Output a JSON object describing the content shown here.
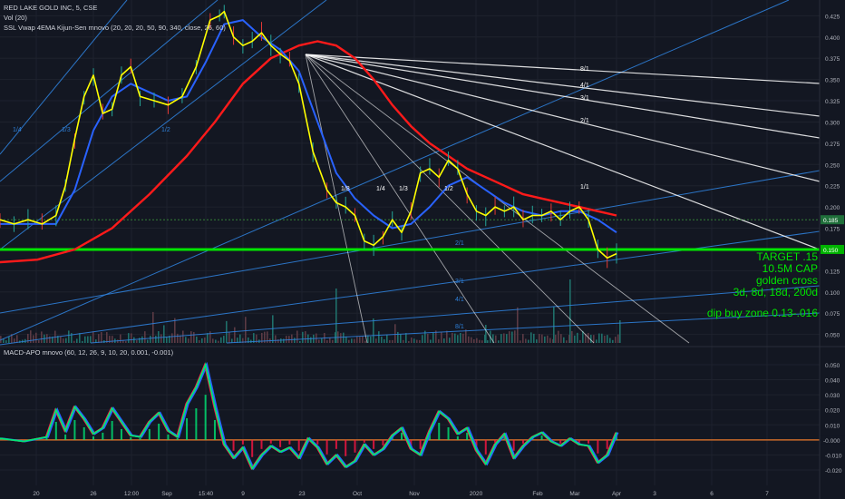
{
  "header": {
    "title": "RED LAKE GOLD INC, 5, CSE",
    "vol": "Vol (20)",
    "indicator": "SSL Vwap 4EMA Kijun-Sen mnovo (20, 20, 20, 50, 90, 340, close, 26, 60)",
    "macd": "MACD-APO mnovo (60, 12, 26, 9, 10, 20, 0.001, -0.001)"
  },
  "annotations": {
    "target": "TARGET .15",
    "cap": "10.5M CAP",
    "cross": "golden cross",
    "periods": "3d, 8d, 18d, 200d",
    "dip": "dip buy zone 0.13-.016"
  },
  "colors": {
    "background": "#131722",
    "price": "#ffff00",
    "ema_blue": "#2962ff",
    "ema_red": "#ff1a1a",
    "target_line": "#00e600",
    "fan": "#ffffff",
    "gann_blue": "#2e7fd8",
    "macd_green": "#00e676",
    "macd_red": "#ff1744",
    "macd_blue": "#2962ff"
  },
  "chart_data": {
    "type": "line",
    "x_ticks": [
      "20",
      "26",
      "12:00",
      "Sep",
      "15:40",
      "9",
      "23",
      "Oct",
      "Nov",
      "2020",
      "Feb",
      "Mar",
      "Apr",
      "3",
      "6",
      "7"
    ],
    "price_axis": {
      "ticks": [
        "0.425",
        "0.400",
        "0.375",
        "0.350",
        "0.325",
        "0.300",
        "0.275",
        "0.250",
        "0.225",
        "0.200",
        "0.175",
        "0.150",
        "0.125",
        "0.100",
        "0.075",
        "0.050"
      ],
      "range": [
        0.04,
        0.435
      ],
      "current_label": "0.185",
      "target_label": "0.150",
      "current_value": 0.185,
      "target_value": 0.15
    },
    "macd_axis": {
      "ticks": [
        "0.050",
        "0.040",
        "0.030",
        "0.020",
        "0.010",
        "0.000",
        "-0.010",
        "-0.020"
      ],
      "range": [
        -0.026,
        0.056
      ],
      "zero_label": "-0.000"
    },
    "fan_labels": [
      "8/1",
      "4/1",
      "3/1",
      "2/1",
      "1/1",
      "1/2",
      "1/3",
      "1/4",
      "1/8"
    ],
    "gann_labels": [
      "1/4",
      "1/3",
      "1/2",
      "2/1",
      "3/1",
      "4/1",
      "8/1"
    ],
    "x_domain": [
      0,
      132
    ],
    "series": [
      {
        "key": "price",
        "x": [
          0,
          3,
          6,
          9,
          12,
          14,
          16,
          18,
          20,
          22,
          24,
          26,
          28,
          30,
          33,
          36,
          39,
          42,
          45,
          47,
          48,
          50,
          52,
          54,
          56,
          58,
          60,
          62,
          64,
          67,
          70,
          72,
          74,
          76,
          78,
          80,
          82,
          84,
          86,
          88,
          90,
          92,
          94,
          96,
          98,
          100,
          102,
          104,
          106,
          108,
          110,
          112,
          114,
          116,
          118,
          120,
          122,
          124,
          126,
          128,
          130,
          132
        ],
        "values": [
          0.185,
          0.18,
          0.185,
          0.18,
          0.19,
          0.225,
          0.28,
          0.33,
          0.355,
          0.31,
          0.315,
          0.355,
          0.365,
          0.33,
          0.325,
          0.32,
          0.33,
          0.365,
          0.42,
          0.425,
          0.43,
          0.4,
          0.39,
          0.395,
          0.405,
          0.39,
          0.38,
          0.372,
          0.345,
          0.265,
          0.22,
          0.205,
          0.2,
          0.19,
          0.16,
          0.155,
          0.165,
          0.185,
          0.17,
          0.195,
          0.24,
          0.245,
          0.235,
          0.255,
          0.245,
          0.215,
          0.195,
          0.19,
          0.2,
          0.195,
          0.2,
          0.185,
          0.19,
          0.19,
          0.195,
          0.185,
          0.195,
          0.2,
          0.185,
          0.15,
          0.14,
          0.145
        ]
      },
      {
        "key": "ema_blue",
        "x": [
          0,
          6,
          12,
          16,
          20,
          24,
          28,
          32,
          36,
          40,
          44,
          48,
          52,
          56,
          60,
          64,
          68,
          72,
          76,
          80,
          84,
          88,
          92,
          96,
          100,
          104,
          108,
          112,
          116,
          120,
          124,
          128,
          132
        ],
        "values": [
          0.18,
          0.18,
          0.18,
          0.22,
          0.29,
          0.33,
          0.345,
          0.335,
          0.325,
          0.33,
          0.37,
          0.415,
          0.42,
          0.4,
          0.385,
          0.36,
          0.3,
          0.24,
          0.21,
          0.19,
          0.175,
          0.18,
          0.2,
          0.225,
          0.235,
          0.22,
          0.205,
          0.195,
          0.19,
          0.195,
          0.195,
          0.185,
          0.17
        ]
      },
      {
        "key": "ema_red",
        "x": [
          0,
          8,
          16,
          24,
          32,
          40,
          46,
          52,
          58,
          64,
          68,
          72,
          76,
          80,
          84,
          88,
          92,
          96,
          100,
          104,
          108,
          112,
          116,
          120,
          124,
          128,
          132
        ],
        "values": [
          0.135,
          0.138,
          0.15,
          0.175,
          0.215,
          0.26,
          0.3,
          0.345,
          0.375,
          0.39,
          0.395,
          0.39,
          0.375,
          0.35,
          0.32,
          0.295,
          0.275,
          0.26,
          0.245,
          0.235,
          0.225,
          0.215,
          0.21,
          0.205,
          0.2,
          0.195,
          0.19
        ]
      },
      {
        "key": "macd_main",
        "x": [
          0,
          5,
          10,
          12,
          14,
          16,
          18,
          20,
          22,
          24,
          26,
          28,
          30,
          32,
          34,
          36,
          38,
          40,
          42,
          44,
          46,
          48,
          50,
          52,
          54,
          56,
          58,
          60,
          62,
          64,
          66,
          68,
          70,
          72,
          74,
          76,
          78,
          80,
          82,
          84,
          86,
          88,
          90,
          92,
          94,
          96,
          98,
          100,
          102,
          104,
          106,
          108,
          110,
          112,
          114,
          116,
          118,
          120,
          122,
          124,
          126,
          128,
          130,
          132
        ],
        "values": [
          0.001,
          -0.001,
          0.002,
          0.02,
          0.006,
          0.022,
          0.014,
          0.004,
          0.008,
          0.021,
          0.012,
          0.003,
          0.002,
          0.012,
          0.018,
          0.006,
          0.002,
          0.024,
          0.035,
          0.05,
          0.022,
          -0.003,
          -0.012,
          -0.005,
          -0.019,
          -0.01,
          -0.004,
          -0.008,
          -0.005,
          -0.012,
          0.001,
          -0.005,
          -0.016,
          -0.01,
          -0.018,
          -0.014,
          -0.003,
          -0.01,
          -0.006,
          0.003,
          0.008,
          -0.006,
          -0.01,
          0.006,
          0.019,
          0.014,
          0.004,
          0.008,
          -0.007,
          -0.016,
          -0.003,
          0.004,
          -0.012,
          -0.004,
          0.002,
          0.005,
          -0.001,
          -0.004,
          0.001,
          -0.003,
          -0.004,
          -0.015,
          -0.01,
          0.005
        ]
      }
    ]
  }
}
